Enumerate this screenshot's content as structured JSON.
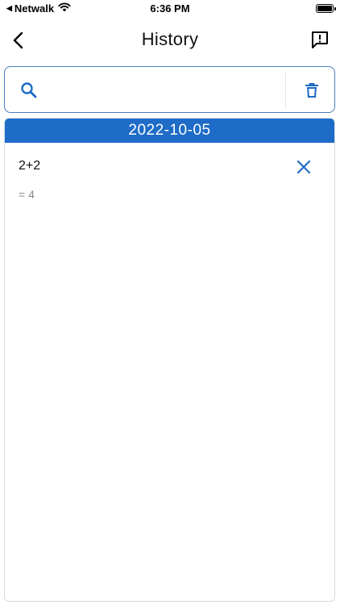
{
  "status_bar": {
    "carrier": "Netwalk",
    "time": "6:36 PM"
  },
  "nav": {
    "title": "History"
  },
  "search": {
    "value": "",
    "placeholder": ""
  },
  "history": {
    "groups": [
      {
        "date": "2022-10-05",
        "items": [
          {
            "expression": "2+2",
            "result": "= 4"
          }
        ]
      }
    ]
  },
  "colors": {
    "accent": "#1e6cc7",
    "border": "#4a7fbd",
    "muted_text": "#8a8a8a"
  },
  "icons": {
    "back": "chevron-left-icon",
    "feedback": "feedback-icon",
    "search": "search-icon",
    "delete_all": "trash-icon",
    "remove_item": "close-icon"
  }
}
